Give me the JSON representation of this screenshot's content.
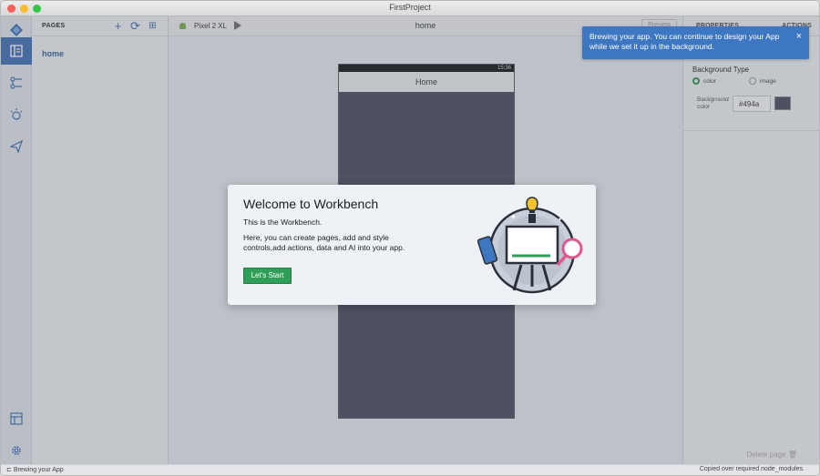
{
  "window": {
    "title": "FirstProject"
  },
  "titlebar_dots": {
    "close": "#fc5f57",
    "minimize": "#fdbc2e",
    "zoom": "#33c748"
  },
  "pages_panel": {
    "label": "PAGES",
    "actions": [
      "add-icon",
      "refresh-icon",
      "component-icon"
    ],
    "items": [
      {
        "label": "home"
      }
    ]
  },
  "toolbar": {
    "device": "Pixel 2 XL",
    "page_name": "home",
    "preview_label": "Preview"
  },
  "phone": {
    "status_time": "15:36",
    "app_title": "Home",
    "background_color": "#494a5c"
  },
  "properties": {
    "tab_properties": "PROPERTIES",
    "tab_actions": "ACTIONS",
    "section": "Background Type",
    "radio_color": "color",
    "radio_image": "image",
    "bg_label_1": "Background",
    "bg_label_2": "color",
    "bg_value": "#494a",
    "delete_page": "Delete page"
  },
  "toast": {
    "message": "Brewing your app. You can continue to design your App while we set it up in the background.",
    "close": "×"
  },
  "modal": {
    "title": "Welcome to Workbench",
    "line1": "This is the Workbench.",
    "line2": "Here, you can create pages, add and style controls,add actions, data and AI into your app.",
    "button": "Let's Start"
  },
  "statusbar": {
    "left": "Brewing your App",
    "right": "Copied over required node_modules."
  },
  "colors": {
    "accent": "#3f6fb7",
    "primary_button": "#2f9e58",
    "toast": "#3d77c2"
  }
}
